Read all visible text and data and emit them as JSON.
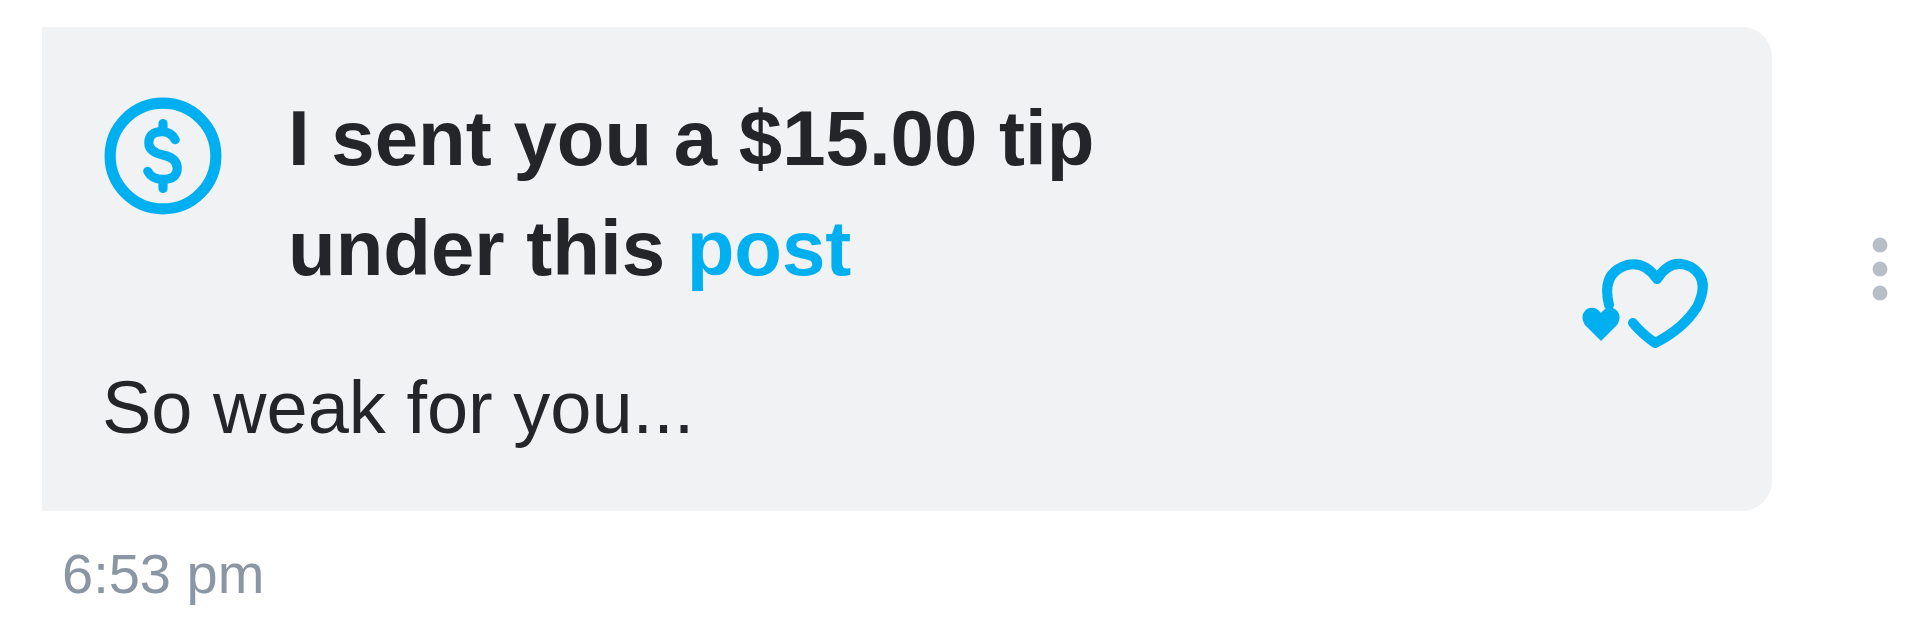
{
  "message": {
    "tip_text": "I sent you a $15.00 tip under this",
    "tip_link": "post",
    "text": "So weak for you...",
    "time": "6:53 pm"
  }
}
